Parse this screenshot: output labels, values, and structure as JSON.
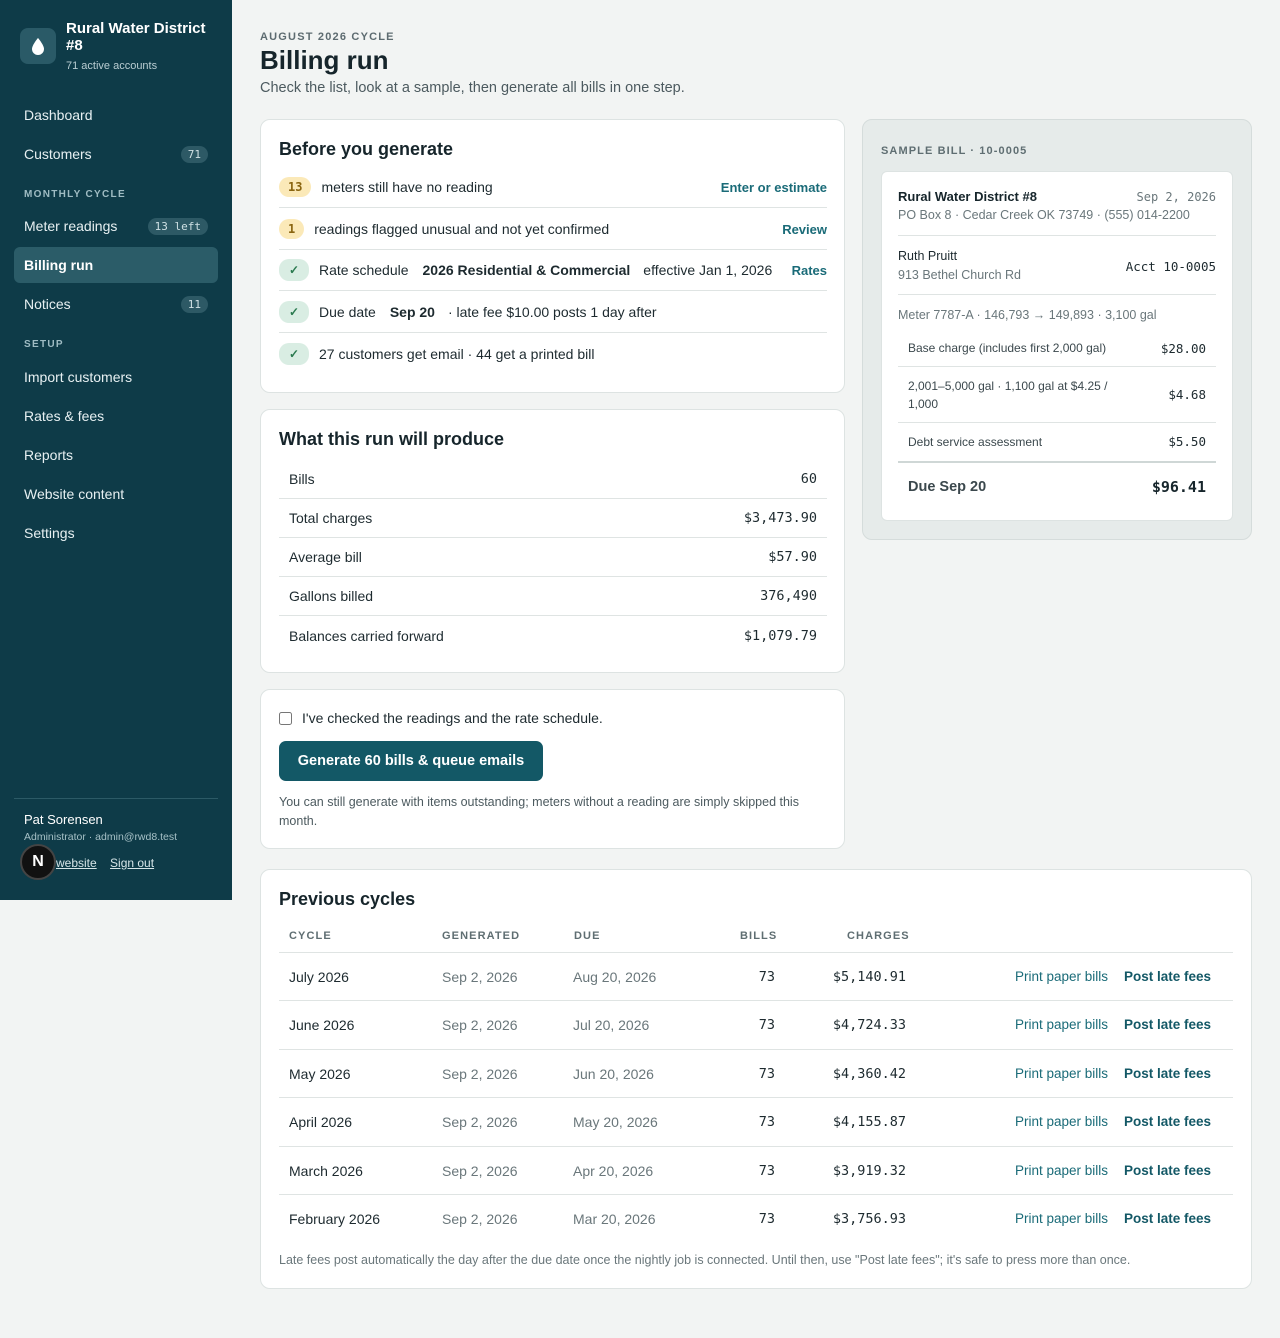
{
  "sidebar": {
    "org_name": "Rural Water District #8",
    "org_sub": "71 active accounts",
    "items": [
      {
        "label": "Dashboard"
      },
      {
        "label": "Customers",
        "badge": "71"
      },
      {
        "label": "Meter readings",
        "badge": "13 left"
      },
      {
        "label": "Billing run",
        "active": true
      },
      {
        "label": "Notices",
        "badge": "11"
      },
      {
        "label": "Import customers"
      },
      {
        "label": "Rates & fees"
      },
      {
        "label": "Reports"
      },
      {
        "label": "Website content"
      },
      {
        "label": "Settings"
      }
    ],
    "sections": {
      "monthly": "MONTHLY CYCLE",
      "setup": "SETUP"
    },
    "user": {
      "name": "Pat Sorensen",
      "role": "Administrator · admin@rwd8.test",
      "link_website": "website",
      "link_signout": "Sign out",
      "avatar_letter": "N"
    }
  },
  "header": {
    "eyebrow": "AUGUST 2026 CYCLE",
    "title": "Billing run",
    "subtitle": "Check the list, look at a sample, then generate all bills in one step."
  },
  "before": {
    "title": "Before you generate",
    "row1": {
      "count": "13",
      "text": "meters still have no reading",
      "link": "Enter or estimate"
    },
    "row2": {
      "count": "1",
      "text": "readings flagged unusual and not yet confirmed",
      "link": "Review"
    },
    "row3": {
      "check": "✓",
      "label": "Rate schedule",
      "value": "2026 Residential & Commercial",
      "suffix": "effective Jan 1, 2026",
      "link": "Rates"
    },
    "row4": {
      "check": "✓",
      "label": "Due date",
      "value": "Sep 20",
      "suffix": "· late fee $10.00 posts 1 day after"
    },
    "row5": {
      "check": "✓",
      "text": "27 customers get email · 44 get a printed bill"
    }
  },
  "produce": {
    "title": "What this run will produce",
    "rows": [
      {
        "label": "Bills",
        "value": "60"
      },
      {
        "label": "Total charges",
        "value": "$3,473.90"
      },
      {
        "label": "Average bill",
        "value": "$57.90"
      },
      {
        "label": "Gallons billed",
        "value": "376,490"
      },
      {
        "label": "Balances carried forward",
        "value": "$1,079.79"
      }
    ]
  },
  "generate": {
    "confirm_label": "I've checked the readings and the rate schedule.",
    "button": "Generate 60 bills & queue emails",
    "note": "You can still generate with items outstanding; meters without a reading are simply skipped this month."
  },
  "sample": {
    "eyebrow": "SAMPLE BILL · 10-0005",
    "org": "Rural Water District #8",
    "date": "Sep 2, 2026",
    "address": "PO Box 8 · Cedar Creek OK 73749 · (555) 014-2200",
    "customer": "Ruth Pruitt",
    "street": "913 Bethel Church Rd",
    "account": "Acct 10-0005",
    "meter": "Meter 7787-A · 146,793 → 149,893 · 3,100 gal",
    "lines": [
      {
        "label": "Base charge (includes first 2,000 gal)",
        "amount": "$28.00"
      },
      {
        "label": "2,001–5,000 gal · 1,100 gal at $4.25 / 1,000",
        "amount": "$4.68"
      },
      {
        "label": "Debt service assessment",
        "amount": "$5.50"
      }
    ],
    "total_label": "Due Sep 20",
    "total_amount": "$96.41"
  },
  "previous": {
    "title": "Previous cycles",
    "headers": {
      "cycle": "CYCLE",
      "generated": "GENERATED",
      "due": "DUE",
      "bills": "BILLS",
      "charges": "CHARGES"
    },
    "rows": [
      {
        "cycle": "July 2026",
        "generated": "Sep 2, 2026",
        "due": "Aug 20, 2026",
        "bills": "73",
        "charges": "$5,140.91",
        "print": "Print paper bills",
        "late": "Post late fees"
      },
      {
        "cycle": "June 2026",
        "generated": "Sep 2, 2026",
        "due": "Jul 20, 2026",
        "bills": "73",
        "charges": "$4,724.33",
        "print": "Print paper bills",
        "late": "Post late fees"
      },
      {
        "cycle": "May 2026",
        "generated": "Sep 2, 2026",
        "due": "Jun 20, 2026",
        "bills": "73",
        "charges": "$4,360.42",
        "print": "Print paper bills",
        "late": "Post late fees"
      },
      {
        "cycle": "April 2026",
        "generated": "Sep 2, 2026",
        "due": "May 20, 2026",
        "bills": "73",
        "charges": "$4,155.87",
        "print": "Print paper bills",
        "late": "Post late fees"
      },
      {
        "cycle": "March 2026",
        "generated": "Sep 2, 2026",
        "due": "Apr 20, 2026",
        "bills": "73",
        "charges": "$3,919.32",
        "print": "Print paper bills",
        "late": "Post late fees"
      },
      {
        "cycle": "February 2026",
        "generated": "Sep 2, 2026",
        "due": "Mar 20, 2026",
        "bills": "73",
        "charges": "$3,756.93",
        "print": "Print paper bills",
        "late": "Post late fees"
      }
    ],
    "footnote": "Late fees post automatically the day after the due date once the nightly job is connected. Until then, use \"Post late fees\"; it's safe to press more than once."
  },
  "colors": {
    "sidebar": "#0e3b48",
    "accent": "#135866",
    "link": "#1a6b78",
    "warn_pill": "#fbe9b8",
    "ok_pill": "#d9ede3"
  }
}
